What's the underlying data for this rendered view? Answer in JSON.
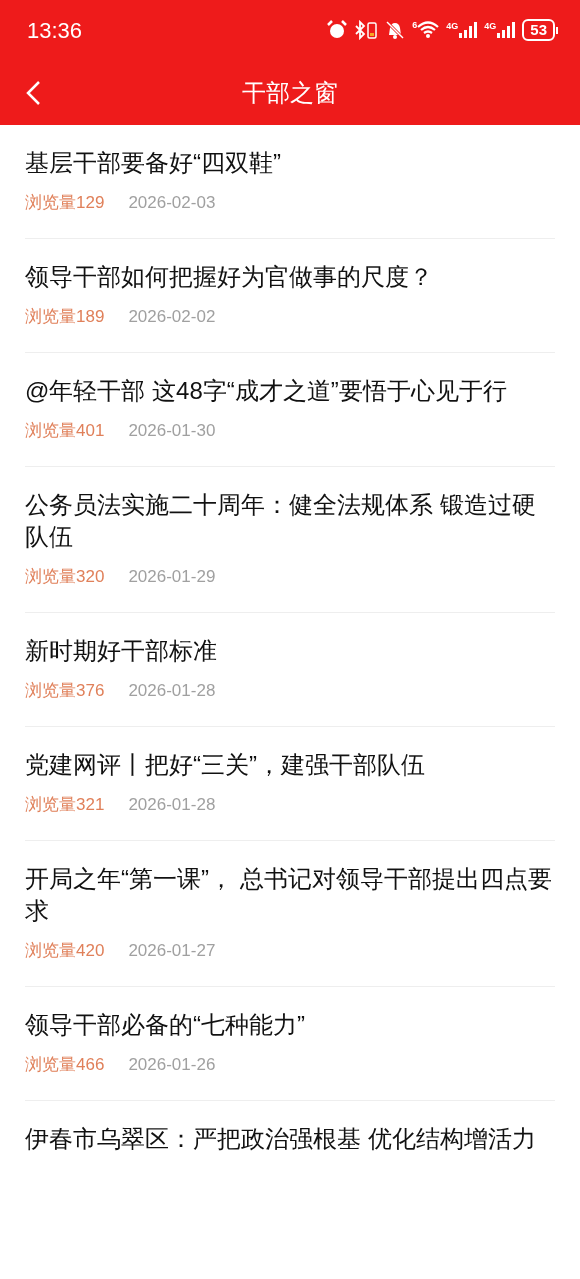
{
  "status_bar": {
    "time": "13:36",
    "wifi_label": "6",
    "signal_labels": [
      "4G",
      "4G"
    ],
    "battery": "53"
  },
  "header": {
    "title": "干部之窗"
  },
  "articles": [
    {
      "title": "基层干部要备好“四双鞋”",
      "views": "浏览量129",
      "date": "2026-02-03"
    },
    {
      "title": "领导干部如何把握好为官做事的尺度？",
      "views": "浏览量189",
      "date": "2026-02-02"
    },
    {
      "title": "@年轻干部 这48字“成才之道”要悟于心见于行",
      "views": "浏览量401",
      "date": "2026-01-30"
    },
    {
      "title": "公务员法实施二十周年：健全法规体系 锻造过硬队伍",
      "views": "浏览量320",
      "date": "2026-01-29"
    },
    {
      "title": "新时期好干部标准",
      "views": "浏览量376",
      "date": "2026-01-28"
    },
    {
      "title": "党建网评丨把好“三关”，建强干部队伍",
      "views": "浏览量321",
      "date": "2026-01-28"
    },
    {
      "title": "开局之年“第一课”， 总书记对领导干部提出四点要求",
      "views": "浏览量420",
      "date": "2026-01-27"
    },
    {
      "title": "领导干部必备的“七种能力”",
      "views": "浏览量466",
      "date": "2026-01-26"
    },
    {
      "title": "伊春市乌翠区：严把政治强根基 优化结构增活力"
    }
  ]
}
